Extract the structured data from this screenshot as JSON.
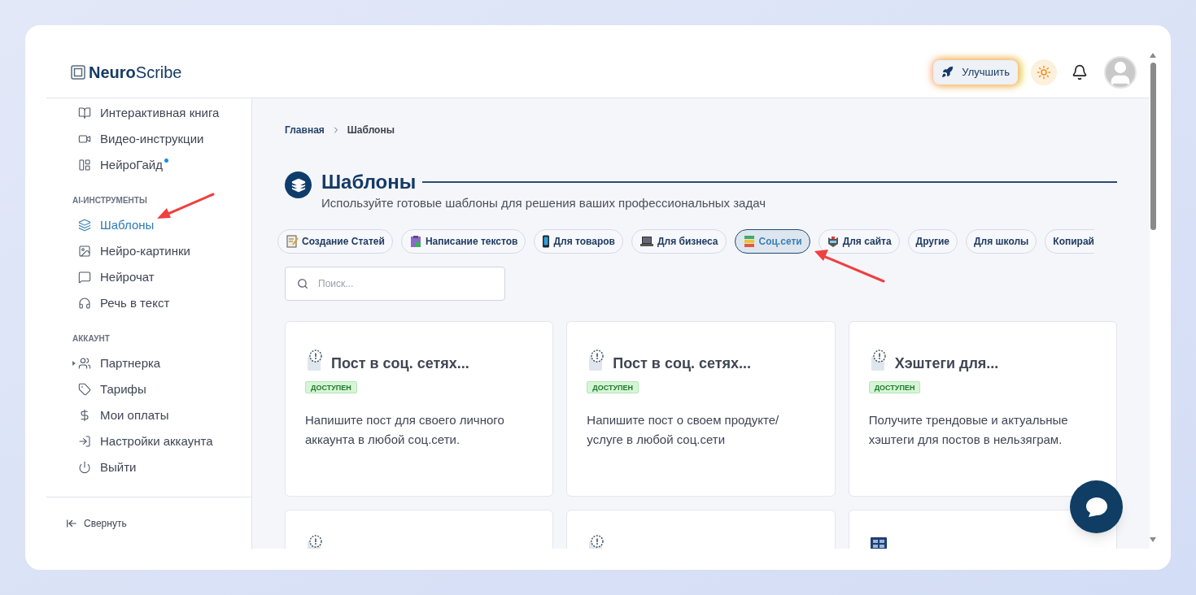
{
  "logo": {
    "bold": "Neuro",
    "light": "Scribe"
  },
  "header": {
    "upgrade_button": "Улучшить"
  },
  "sidebar": {
    "groups": [
      {
        "items": [
          {
            "label": "Интерактивная книга",
            "selected": false,
            "dot": false
          },
          {
            "label": "Видео-инструкции",
            "selected": false,
            "dot": false
          },
          {
            "label": "НейроГайд",
            "selected": false,
            "dot": true
          }
        ]
      },
      {
        "title": "AI-ИНСТРУМЕНТЫ",
        "items": [
          {
            "label": "Шаблоны",
            "selected": true,
            "dot": false
          },
          {
            "label": "Нейро-картинки",
            "selected": false,
            "dot": false
          },
          {
            "label": "Нейрочат",
            "selected": false,
            "dot": false
          },
          {
            "label": "Речь в текст",
            "selected": false,
            "dot": false
          }
        ]
      },
      {
        "title": "АККАУНТ",
        "items": [
          {
            "label": "Партнерка",
            "selected": false,
            "dot": false,
            "expanded": false
          },
          {
            "label": "Тарифы",
            "selected": false,
            "dot": false
          },
          {
            "label": "Мои оплаты",
            "selected": false,
            "dot": false
          },
          {
            "label": "Настройки аккаунта",
            "selected": false,
            "dot": false
          },
          {
            "label": "Выйти",
            "selected": false,
            "dot": false
          }
        ]
      }
    ],
    "collapse": "Свернуть"
  },
  "breadcrumb": [
    "Главная",
    "Шаблоны"
  ],
  "page": {
    "title": "Шаблоны",
    "subtitle": "Используйте готовые шаблоны для решения ваших профессиональных задач"
  },
  "chips": [
    {
      "label": "Создание Статей",
      "kind": "emoji",
      "selected": false
    },
    {
      "label": "Написание текстов",
      "kind": "emoji",
      "selected": false
    },
    {
      "label": "Для товаров",
      "kind": "emoji",
      "selected": false
    },
    {
      "label": "Для бизнеса",
      "kind": "emoji",
      "selected": false
    },
    {
      "label": "Соц.сети",
      "kind": "emoji",
      "selected": true
    },
    {
      "label": "Для сайта",
      "kind": "emoji",
      "selected": false
    },
    {
      "label": "Другие",
      "kind": "plain",
      "selected": false
    },
    {
      "label": "Для школы",
      "kind": "plain",
      "selected": false
    },
    {
      "label": "Копирай",
      "kind": "plain",
      "selected": false
    }
  ],
  "search": {
    "placeholder": "Поиск..."
  },
  "cards": [
    {
      "title": "Пост в соц. сетях...",
      "badge": "ДОСТУПЕН",
      "description": "Напишите пост для своего личного аккаунта в любой соц.сети."
    },
    {
      "title": "Пост в соц. сетях...",
      "badge": "ДОСТУПЕН",
      "description": "Напишите пост о своем продукте/ услуге в любой соц.сети"
    },
    {
      "title": "Хэштеги для...",
      "badge": "ДОСТУПЕН",
      "description": "Получите трендовые и актуальные хэштеги для постов в нельзяграм."
    }
  ],
  "more_cards": [
    {
      "kind": "note"
    },
    {
      "kind": "note"
    },
    {
      "kind": "film"
    }
  ]
}
